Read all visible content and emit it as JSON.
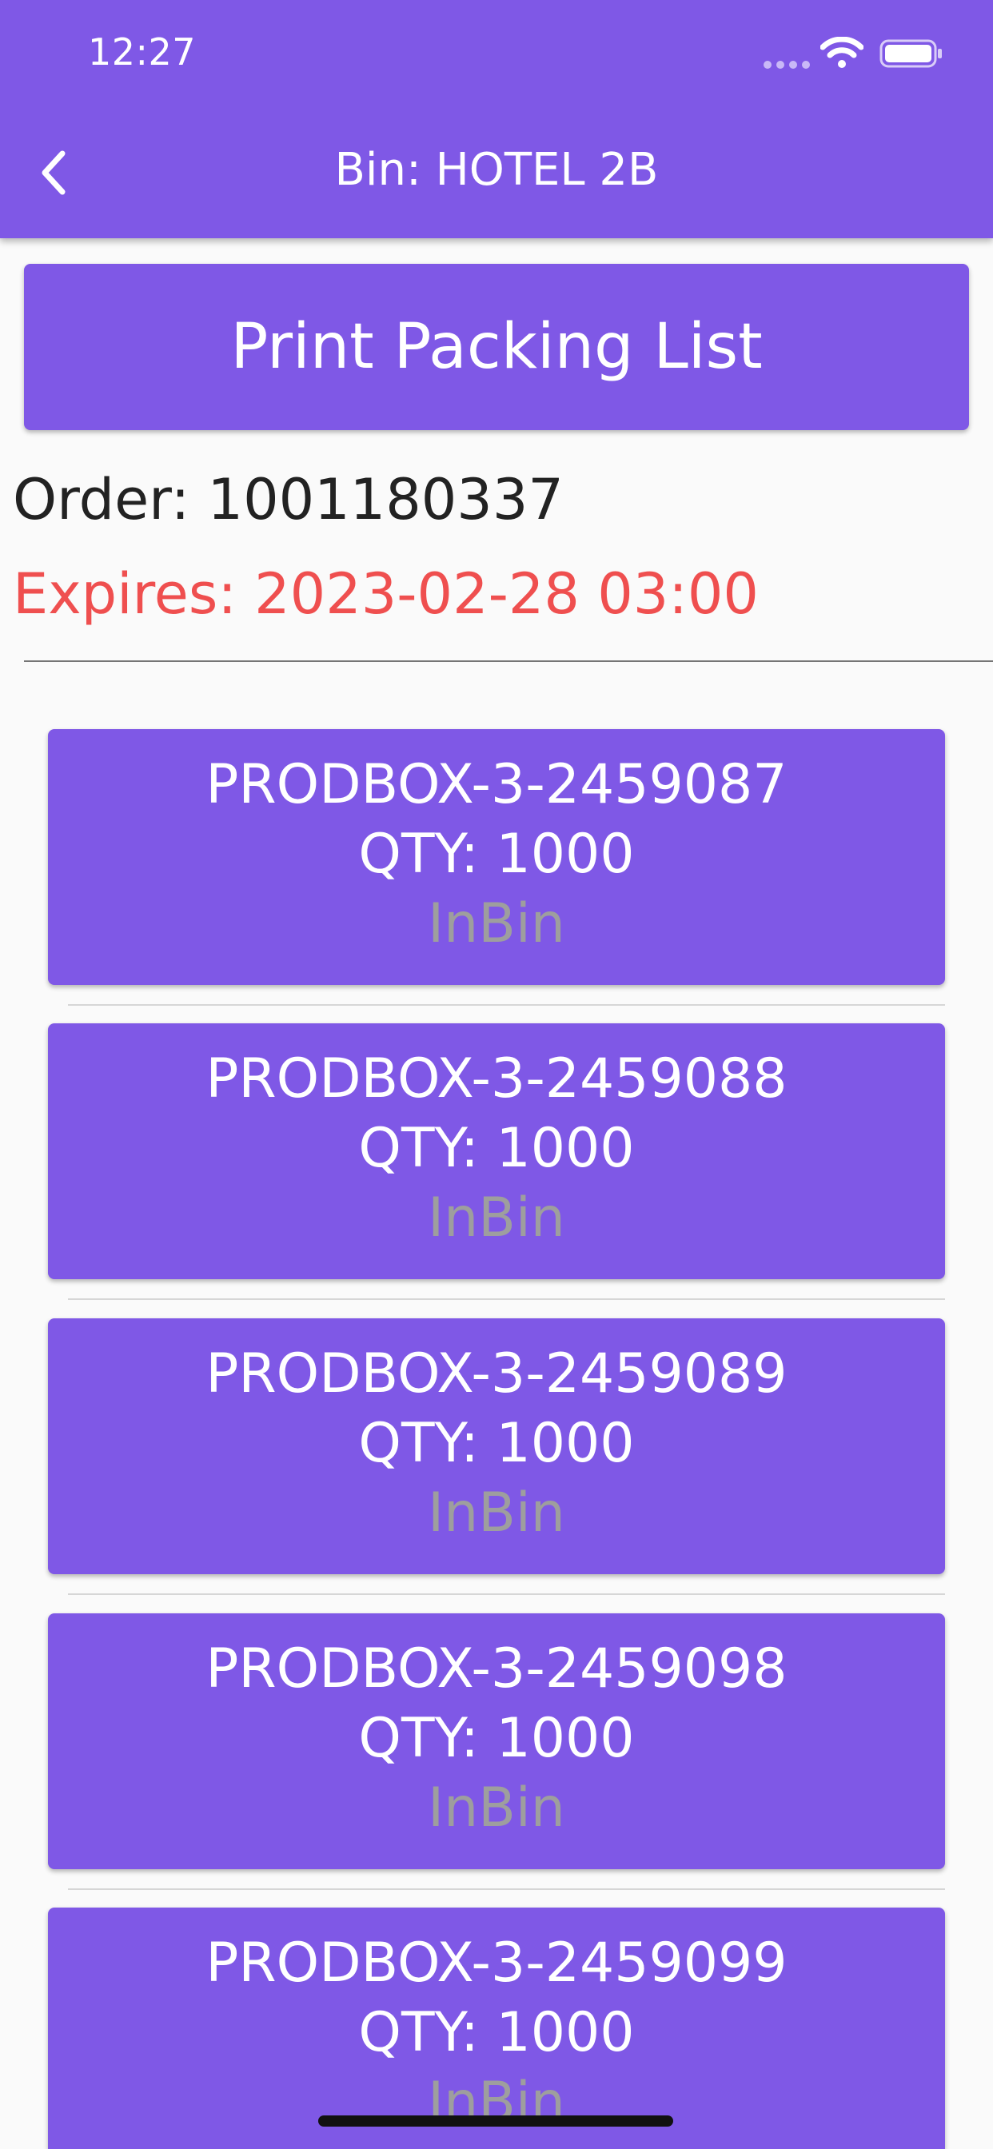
{
  "status_bar": {
    "time": "12:27",
    "signal_icon": "signal-dots-icon",
    "wifi_icon": "wifi-icon",
    "battery_icon": "battery-icon"
  },
  "app_bar": {
    "back_icon": "chevron-left-icon",
    "title": "Bin: HOTEL 2B",
    "background_color": "#7f58e6"
  },
  "actions": {
    "print_label": "Print Packing List"
  },
  "order": {
    "order_text": "Order: 1001180337",
    "expires_text": "Expires: 2023-02-28 03:00",
    "expires_color": "#ef4f4f"
  },
  "boxes": [
    {
      "id": "PRODBOX-3-2459087",
      "qty": "QTY: 1000",
      "status": "InBin"
    },
    {
      "id": "PRODBOX-3-2459088",
      "qty": "QTY: 1000",
      "status": "InBin"
    },
    {
      "id": "PRODBOX-3-2459089",
      "qty": "QTY: 1000",
      "status": "InBin"
    },
    {
      "id": "PRODBOX-3-2459098",
      "qty": "QTY: 1000",
      "status": "InBin"
    },
    {
      "id": "PRODBOX-3-2459099",
      "qty": "QTY: 1000",
      "status": "InBin"
    }
  ]
}
